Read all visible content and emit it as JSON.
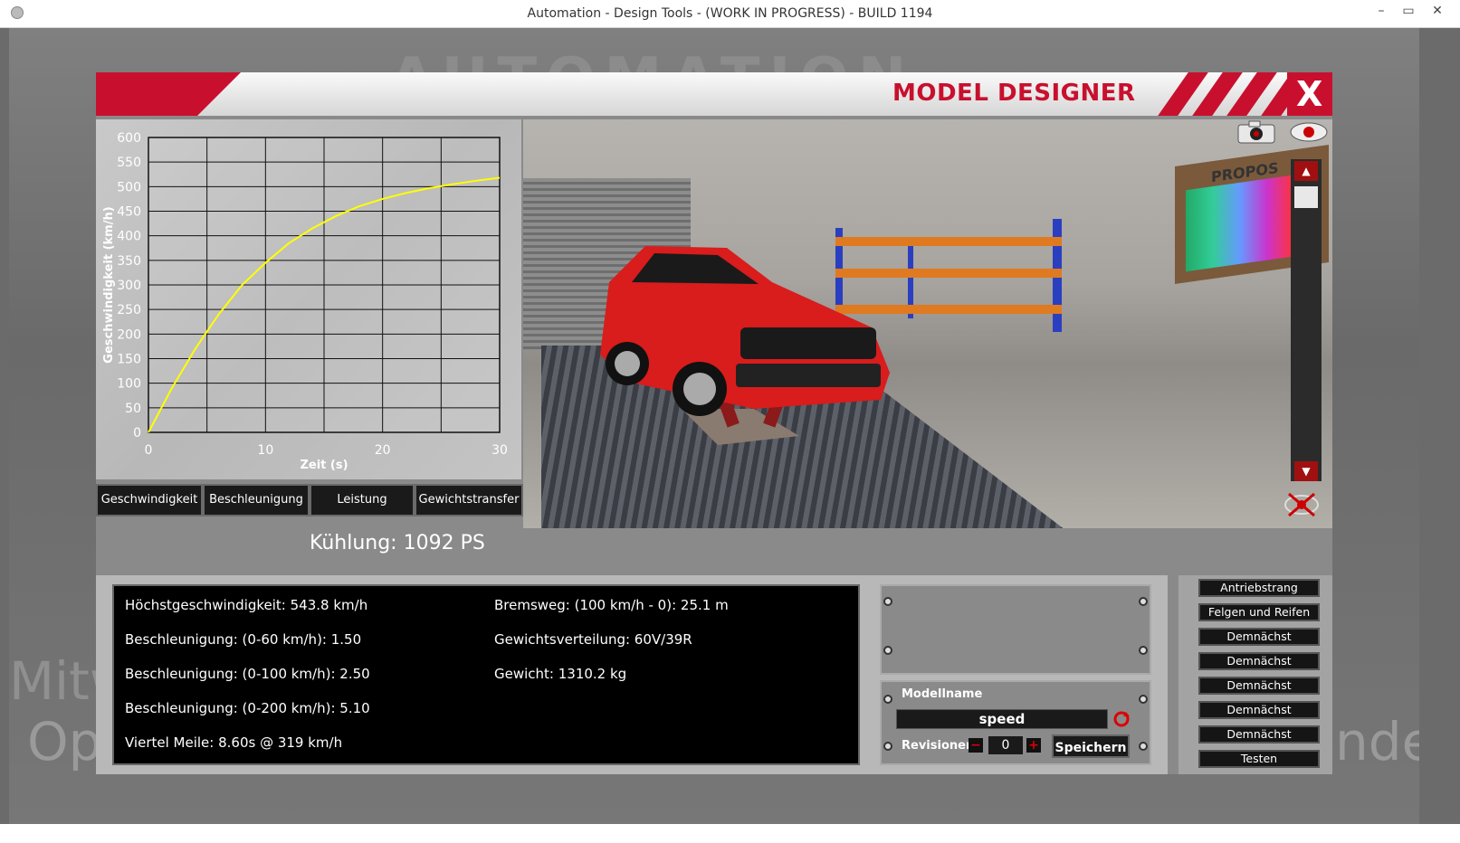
{
  "window": {
    "title": "Automation - Design Tools - (WORK IN PROGRESS) - BUILD 1194",
    "min": "–",
    "max": "▭",
    "close": "✕"
  },
  "background": {
    "logo": "AUTOMATION",
    "left_text_1": "Mitw",
    "left_text_2": "Op",
    "right_text_1": "nde"
  },
  "header": {
    "title": "MODEL DESIGNER",
    "close": "X"
  },
  "chart_tabs": [
    "Geschwindigkeit",
    "Beschleunigung",
    "Leistung",
    "Gewichtstransfer"
  ],
  "cooling": "Kühlung: 1092 PS",
  "chart_data": {
    "type": "line",
    "xlabel": "Zeit (s)",
    "ylabel": "Geschwindigkeit (km/h)",
    "xlim": [
      0,
      30
    ],
    "ylim": [
      0,
      600
    ],
    "x_ticks": [
      "0",
      "10",
      "20",
      "30"
    ],
    "y_ticks": [
      "0",
      "50",
      "100",
      "150",
      "200",
      "250",
      "300",
      "350",
      "400",
      "450",
      "500",
      "550",
      "600"
    ],
    "grid": true,
    "series": [
      {
        "color": "#ffff00",
        "x": [
          0,
          2,
          4,
          5,
          6,
          8,
          10,
          12,
          14,
          16,
          18,
          20,
          22,
          24,
          26,
          28,
          30
        ],
        "y": [
          0,
          90,
          170,
          205,
          240,
          300,
          345,
          385,
          415,
          440,
          460,
          475,
          487,
          497,
          505,
          512,
          518
        ]
      }
    ]
  },
  "scene": {
    "board_label": "PROPOS"
  },
  "stats": {
    "top_speed": "Höchstgeschwindigkeit: 543.8 km/h",
    "accel_60": "Beschleunigung: (0-60 km/h): 1.50",
    "accel_100": "Beschleunigung: (0-100 km/h): 2.50",
    "accel_200": "Beschleunigung: (0-200 km/h): 5.10",
    "quarter_mile": "Viertel Meile: 8.60s @ 319 km/h",
    "braking": "Bremsweg: (100 km/h - 0): 25.1 m",
    "weight_dist": "Gewichtsverteilung: 60V/39R",
    "weight": "Gewicht: 1310.2 kg"
  },
  "model": {
    "label": "Modellname",
    "name_value": "speed",
    "revisions_label": "Revisionen",
    "minus": "−",
    "revision_value": "0",
    "plus": "+",
    "save": "Speichern"
  },
  "menu": [
    "Antriebstrang",
    "Felgen und Reifen",
    "Demnächst",
    "Demnächst",
    "Demnächst",
    "Demnächst",
    "Demnächst",
    "Testen"
  ],
  "colors": {
    "accent_red": "#c8102e",
    "curve_yellow": "#ffff00"
  }
}
